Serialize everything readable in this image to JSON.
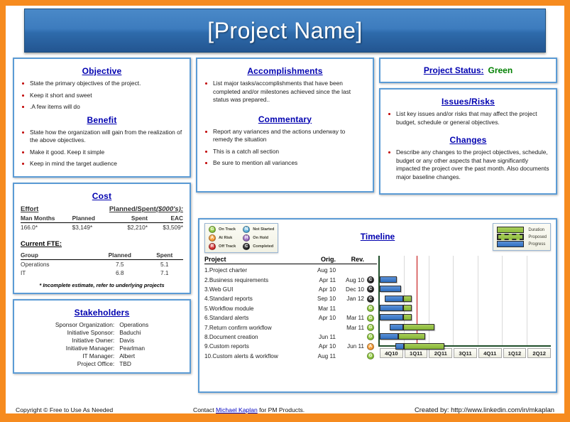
{
  "title": "[Project Name]",
  "objective": {
    "heading": "Objective",
    "items": [
      "State the primary objectives of the project.",
      "Keep it short and sweet",
      ".A few items will do"
    ]
  },
  "benefit": {
    "heading": "Benefit",
    "items": [
      "State how the organization will gain from the realization of the above objectives.",
      "Make it good. Keep it simple",
      "Keep in mind the target audience"
    ]
  },
  "accomplishments": {
    "heading": "Accomplishments",
    "items": [
      "List major tasks/accomplishments that have been completed and/or milestones achieved since the last status was prepared.."
    ]
  },
  "commentary": {
    "heading": "Commentary",
    "items": [
      "Report any variances and the actions underway to remedy the situation",
      "This is a catch all section",
      "Be  sure to mention all variances"
    ]
  },
  "project_status": {
    "label": "Project Status:",
    "value": "Green",
    "color": "#008000"
  },
  "issues_risks": {
    "heading": "Issues/Risks",
    "items": [
      "List key issues and/or risks that may affect the project budget, schedule or general objectives."
    ]
  },
  "changes": {
    "heading": "Changes",
    "items": [
      "Describe any changes to the project objectives, schedule, budget or any other aspects that have significantly impacted the project over the past month. Also documents major baseline changes."
    ]
  },
  "cost": {
    "heading": "Cost",
    "effort_label": "Effort",
    "planned_spent_label": "Planned/Spent",
    "planned_spent_units": "($000's):",
    "headers": [
      "Man Months",
      "Planned",
      "Spent",
      "EAC"
    ],
    "values": [
      "166.0*",
      "$3,149*",
      "$2,210*",
      "$3,509*"
    ],
    "fte_label": "Current FTE:",
    "fte_headers": [
      "Group",
      "Planned",
      "Spent"
    ],
    "fte_rows": [
      [
        "Operations",
        "7.5",
        "5.1"
      ],
      [
        "IT",
        "6.8",
        "7.1"
      ]
    ],
    "footnote": "* Incomplete estimate, refer to underlying projects"
  },
  "stakeholders": {
    "heading": "Stakeholders",
    "rows": [
      [
        "Sponsor Organization:",
        "Operations"
      ],
      [
        "Initiative Sponsor:",
        "Baduchi"
      ],
      [
        "Initiative Owner:",
        "Davis"
      ],
      [
        "Initiative Manager:",
        "Pearlman"
      ],
      [
        "IT Manager:",
        "Albert"
      ],
      [
        "Project Office:",
        "TBD"
      ]
    ]
  },
  "timeline": {
    "heading": "Timeline",
    "status_legend": [
      {
        "code": "G",
        "label": "On Track",
        "key": "G"
      },
      {
        "code": "A",
        "label": "At Risk",
        "key": "A"
      },
      {
        "code": "R",
        "label": "Off Track",
        "key": "R"
      },
      {
        "code": "N",
        "label": "Not Started",
        "key": "N"
      },
      {
        "code": "H",
        "label": "On Hold",
        "key": "H"
      },
      {
        "code": "C",
        "label": "Completed",
        "key": "C"
      }
    ],
    "bar_legend": [
      {
        "label": "Duration",
        "style": "dur"
      },
      {
        "label": "Proposed",
        "style": "prop"
      },
      {
        "label": "Progress",
        "style": "prog"
      }
    ],
    "headers": [
      "Project",
      "Orig.",
      "Rev."
    ],
    "quarters": [
      "4Q10",
      "1Q11",
      "2Q11",
      "3Q11",
      "4Q11",
      "1Q12",
      "2Q12"
    ],
    "today_marker_quarter_fraction": 1.5,
    "tasks": [
      {
        "n": "1.Project charter",
        "orig": "Aug 10",
        "rev": "",
        "status": ""
      },
      {
        "n": "2.Business requirements",
        "orig": "Apr 11",
        "rev": "Aug 10",
        "status": "C"
      },
      {
        "n": "3.Web GUI",
        "orig": "Apr 10",
        "rev": "Dec 10",
        "status": "C"
      },
      {
        "n": "4.Standard reports",
        "orig": "Sep 10",
        "rev": "Jan 12",
        "status": "C"
      },
      {
        "n": "5.Workflow module",
        "orig": "Mar 11",
        "rev": "",
        "status": "G"
      },
      {
        "n": "6.Standard alerts",
        "orig": "Apr 10",
        "rev": "Mar 11",
        "status": "G"
      },
      {
        "n": "7.Return confirm workflow",
        "orig": "",
        "rev": "Mar 11",
        "status": "G"
      },
      {
        "n": "8.Document creation",
        "orig": "Jun 11",
        "rev": "",
        "status": "G"
      },
      {
        "n": "9.Custom reports",
        "orig": "Apr 10",
        "rev": "Jun 11",
        "status": "A"
      },
      {
        "n": "10.Custom alerts & workflow",
        "orig": "Aug 11",
        "rev": "",
        "status": "G"
      }
    ],
    "bars": [
      {
        "progress": null,
        "duration": null
      },
      {
        "progress": null,
        "duration": null
      },
      {
        "progress": [
          0.0,
          0.7
        ],
        "duration": null
      },
      {
        "progress": [
          0.0,
          0.88
        ],
        "duration": null
      },
      {
        "progress": [
          0.2,
          0.95
        ],
        "duration": [
          0.95,
          1.3
        ]
      },
      {
        "progress": [
          0.0,
          0.95
        ],
        "duration": [
          0.95,
          1.3
        ]
      },
      {
        "progress": [
          0.0,
          0.95
        ],
        "duration": [
          0.95,
          1.3
        ]
      },
      {
        "progress": [
          0.4,
          0.95
        ],
        "duration": [
          0.95,
          2.25
        ]
      },
      {
        "progress": [
          0.0,
          0.75
        ],
        "duration": [
          0.75,
          1.85
        ]
      },
      {
        "progress": [
          0.65,
          1.0
        ],
        "duration": [
          1.0,
          2.65
        ]
      }
    ]
  },
  "footer": {
    "copyright": "Copyright © Free to  Use As Needed",
    "contact_pre": "Contact ",
    "contact_link": "Michael Kaplan",
    "contact_post": " for PM Products.",
    "created_by": "Created by: http://www.linkedin.com/in/mkaplan"
  }
}
